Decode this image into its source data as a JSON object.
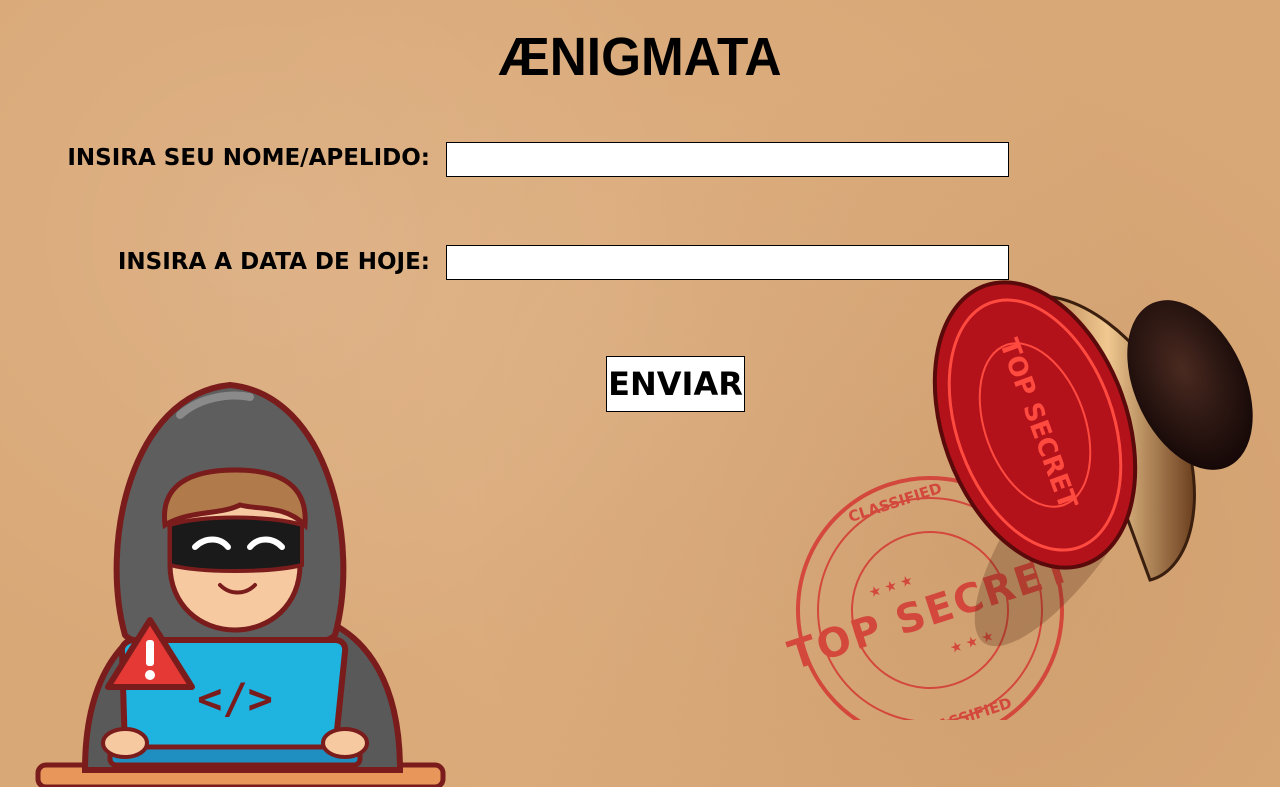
{
  "page": {
    "title": "ÆNIGMATA"
  },
  "form": {
    "name_label": "INSIRA SEU NOME/APELIDO:",
    "name_value": "",
    "date_label": "INSIRA A DATA DE HOJE:",
    "date_value": "",
    "submit_label": "ENVIAR"
  },
  "stamp": {
    "top_text": "CLASSIFIED",
    "center_text": "TOP SECRET",
    "bottom_text": "CLASSIFIED"
  },
  "colors": {
    "background": "#d9a877",
    "stamp_red": "#d42a2a",
    "hoodie": "#555555",
    "laptop": "#1fb3e0",
    "warning": "#e53935"
  }
}
